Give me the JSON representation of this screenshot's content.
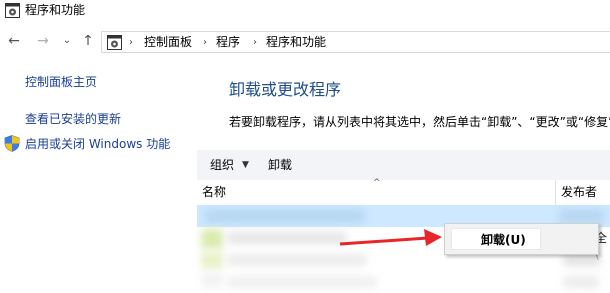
{
  "window": {
    "title": "程序和功能"
  },
  "navbar": {
    "back_glyph": "←",
    "forward_glyph": "→",
    "recent_glyph": "⌄",
    "up_glyph": "↑",
    "breadcrumbs": [
      "控制面板",
      "程序",
      "程序和功能"
    ],
    "separator": "›"
  },
  "sidebar": {
    "items": [
      {
        "label": "控制面板主页"
      },
      {
        "label": "查看已安装的更新"
      },
      {
        "label": "启用或关闭 Windows 功能"
      }
    ]
  },
  "main": {
    "heading": "卸载或更改程序",
    "instructions": "若要卸载程序，请从列表中将其选中，然后单击“卸载”、“更改”或“修复”。"
  },
  "toolbar": {
    "organize_label": "组织",
    "organize_arrow": "▼",
    "uninstall_label": "卸载"
  },
  "table": {
    "columns": [
      {
        "label": "名称"
      },
      {
        "label": "发布者"
      }
    ],
    "sort_glyph": "^",
    "row_tail_text": "全("
  },
  "context_menu": {
    "items": [
      {
        "label": "卸载(U)"
      }
    ]
  },
  "colors": {
    "link": "#1a3f93",
    "heading": "#1e4e8c",
    "selection": "#cde8ff",
    "arrow": "#e8262a"
  }
}
